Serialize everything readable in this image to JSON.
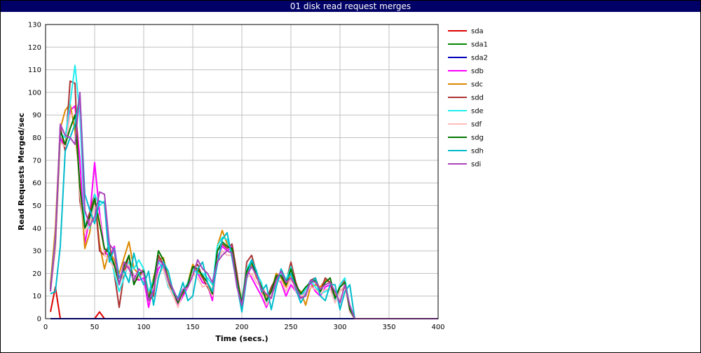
{
  "window": {
    "title": "01 disk read request merges"
  },
  "chart_data": {
    "type": "line",
    "title": "01 disk read request merges",
    "xlabel": "Time (secs.)",
    "ylabel": "Read Requests Merged/sec",
    "xlim": [
      0,
      400
    ],
    "ylim": [
      0,
      130
    ],
    "xticks": [
      0,
      50,
      100,
      150,
      200,
      250,
      300,
      350,
      400
    ],
    "yticks": [
      0,
      10,
      20,
      30,
      40,
      50,
      60,
      70,
      80,
      90,
      100,
      110,
      120,
      130
    ],
    "grid": true,
    "legend_position": "right",
    "x": [
      5,
      10,
      15,
      20,
      25,
      30,
      35,
      40,
      45,
      50,
      55,
      60,
      65,
      70,
      75,
      80,
      85,
      90,
      95,
      100,
      105,
      110,
      115,
      120,
      125,
      130,
      135,
      140,
      145,
      150,
      155,
      160,
      165,
      170,
      175,
      180,
      185,
      190,
      195,
      200,
      205,
      210,
      215,
      220,
      225,
      230,
      235,
      240,
      245,
      250,
      255,
      260,
      265,
      270,
      275,
      280,
      285,
      290,
      295,
      300,
      305,
      310,
      315,
      320,
      325,
      330,
      340,
      350,
      360,
      370,
      380,
      390,
      400
    ],
    "series": [
      {
        "name": "sda",
        "color": "#dd0000",
        "values": [
          3,
          14,
          0,
          0,
          0,
          0,
          0,
          0,
          0,
          0,
          3,
          0,
          0,
          0,
          0,
          0,
          0,
          0,
          0,
          0,
          0,
          0,
          0,
          0,
          0,
          0,
          0,
          0,
          0,
          0,
          0,
          0,
          0,
          0,
          0,
          0,
          0,
          0,
          0,
          0,
          0,
          0,
          0,
          0,
          0,
          0,
          0,
          0,
          0,
          0,
          0,
          0,
          0,
          0,
          0,
          0,
          0,
          0,
          0,
          0,
          0,
          0,
          0,
          0,
          0,
          0,
          0,
          0,
          0,
          0,
          0,
          0,
          0
        ]
      },
      {
        "name": "sda1",
        "color": "#008800",
        "values": [
          0,
          0,
          0,
          0,
          0,
          0,
          0,
          0,
          0,
          0,
          0,
          0,
          0,
          0,
          0,
          0,
          0,
          0,
          0,
          0,
          0,
          0,
          0,
          0,
          0,
          0,
          0,
          0,
          0,
          0,
          0,
          0,
          0,
          0,
          0,
          0,
          0,
          0,
          0,
          0,
          0,
          0,
          0,
          0,
          0,
          0,
          0,
          0,
          0,
          0,
          0,
          0,
          0,
          0,
          0,
          0,
          0,
          0,
          0,
          0,
          0,
          0,
          0,
          0,
          0,
          0,
          0,
          0,
          0,
          0,
          0,
          0,
          0
        ]
      },
      {
        "name": "sda2",
        "color": "#0000bb",
        "values": [
          0,
          0,
          0,
          0,
          0,
          0,
          0,
          0,
          0,
          0,
          0,
          0,
          0,
          0,
          0,
          0,
          0,
          0,
          0,
          0,
          0,
          0,
          0,
          0,
          0,
          0,
          0,
          0,
          0,
          0,
          0,
          0,
          0,
          0,
          0,
          0,
          0,
          0,
          0,
          0,
          0,
          0,
          0,
          0,
          0,
          0,
          0,
          0,
          0,
          0,
          0,
          0,
          0,
          0,
          0,
          0,
          0,
          0,
          0,
          0,
          0,
          0,
          0,
          0,
          0,
          0,
          0,
          0,
          0,
          0,
          0,
          0,
          0
        ]
      },
      {
        "name": "sdb",
        "color": "#ff00ff",
        "values": [
          12,
          38,
          80,
          75,
          92,
          94,
          70,
          33,
          45,
          69,
          47,
          30,
          27,
          32,
          18,
          22,
          23,
          19,
          17,
          18,
          5,
          15,
          22,
          25,
          15,
          10,
          6,
          10,
          14,
          23,
          20,
          16,
          15,
          8,
          27,
          32,
          30,
          32,
          15,
          5,
          22,
          18,
          14,
          10,
          5,
          10,
          18,
          16,
          10,
          15,
          12,
          9,
          13,
          16,
          12,
          10,
          14,
          15,
          9,
          14,
          16,
          3,
          0,
          0,
          0,
          0,
          0,
          0,
          0,
          0,
          0,
          0,
          0
        ]
      },
      {
        "name": "sdc",
        "color": "#dd8800",
        "values": [
          15,
          40,
          84,
          92,
          95,
          83,
          60,
          31,
          38,
          54,
          33,
          22,
          30,
          26,
          20,
          27,
          34,
          22,
          20,
          21,
          10,
          18,
          26,
          27,
          18,
          12,
          8,
          12,
          16,
          24,
          21,
          18,
          14,
          12,
          32,
          39,
          33,
          30,
          18,
          8,
          20,
          24,
          18,
          15,
          10,
          12,
          20,
          18,
          14,
          20,
          14,
          12,
          6,
          14,
          15,
          14,
          17,
          16,
          10,
          12,
          14,
          5,
          0,
          0,
          0,
          0,
          0,
          0,
          0,
          0,
          0,
          0,
          0
        ]
      },
      {
        "name": "sdd",
        "color": "#aa3333",
        "values": [
          14,
          35,
          85,
          74,
          105,
          104,
          52,
          40,
          47,
          55,
          30,
          28,
          33,
          20,
          5,
          20,
          28,
          16,
          18,
          22,
          8,
          10,
          28,
          24,
          16,
          12,
          7,
          11,
          15,
          22,
          24,
          18,
          14,
          10,
          30,
          33,
          31,
          33,
          20,
          5,
          25,
          28,
          20,
          12,
          8,
          14,
          18,
          20,
          16,
          25,
          16,
          10,
          13,
          17,
          18,
          12,
          18,
          16,
          8,
          15,
          17,
          4,
          0,
          0,
          0,
          0,
          0,
          0,
          0,
          0,
          0,
          0,
          0
        ]
      },
      {
        "name": "sde",
        "color": "#22eeee",
        "values": [
          13,
          36,
          82,
          80,
          95,
          112,
          90,
          42,
          40,
          55,
          50,
          52,
          30,
          20,
          12,
          18,
          25,
          22,
          26,
          22,
          12,
          17,
          25,
          22,
          14,
          11,
          9,
          12,
          16,
          22,
          20,
          20,
          18,
          15,
          32,
          36,
          35,
          28,
          16,
          8,
          22,
          26,
          20,
          16,
          7,
          10,
          15,
          20,
          17,
          23,
          14,
          10,
          13,
          17,
          14,
          11,
          12,
          13,
          8,
          15,
          18,
          5,
          0,
          0,
          0,
          0,
          0,
          0,
          0,
          0,
          0,
          0,
          0
        ]
      },
      {
        "name": "sdf",
        "color": "#ffbbbb",
        "values": [
          12,
          30,
          78,
          76,
          90,
          90,
          55,
          38,
          42,
          50,
          45,
          28,
          26,
          22,
          16,
          20,
          24,
          18,
          18,
          20,
          10,
          14,
          20,
          22,
          15,
          10,
          5,
          12,
          14,
          20,
          18,
          14,
          15,
          10,
          26,
          30,
          28,
          28,
          16,
          6,
          18,
          20,
          16,
          14,
          6,
          10,
          16,
          17,
          12,
          18,
          12,
          10,
          11,
          14,
          13,
          11,
          13,
          13,
          7,
          12,
          15,
          3,
          0,
          0,
          0,
          0,
          0,
          0,
          0,
          0,
          0,
          0,
          0
        ]
      },
      {
        "name": "sdg",
        "color": "#007700",
        "values": [
          13,
          34,
          83,
          77,
          84,
          90,
          58,
          40,
          45,
          53,
          42,
          31,
          29,
          24,
          15,
          23,
          28,
          15,
          20,
          21,
          9,
          16,
          30,
          26,
          17,
          12,
          7,
          12,
          15,
          23,
          22,
          19,
          16,
          11,
          30,
          34,
          32,
          31,
          17,
          7,
          21,
          25,
          19,
          14,
          8,
          12,
          19,
          19,
          15,
          22,
          15,
          11,
          14,
          16,
          17,
          12,
          16,
          18,
          9,
          14,
          16,
          4,
          0,
          0,
          0,
          0,
          0,
          0,
          0,
          0,
          0,
          0,
          0
        ]
      },
      {
        "name": "sdh",
        "color": "#00bbcc",
        "values": [
          11,
          12,
          32,
          74,
          80,
          86,
          99,
          55,
          48,
          42,
          52,
          51,
          25,
          31,
          18,
          21,
          16,
          29,
          20,
          15,
          21,
          6,
          18,
          25,
          21,
          12,
          9,
          16,
          8,
          10,
          22,
          25,
          16,
          12,
          24,
          35,
          38,
          27,
          15,
          3,
          18,
          26,
          21,
          12,
          15,
          4,
          14,
          22,
          17,
          20,
          13,
          7,
          11,
          16,
          18,
          10,
          8,
          15,
          15,
          4,
          12,
          15,
          0,
          0,
          0,
          0,
          0,
          0,
          0,
          0,
          0,
          0,
          0
        ]
      },
      {
        "name": "sdi",
        "color": "#aa44bb",
        "values": [
          12,
          35,
          86,
          81,
          80,
          77,
          100,
          48,
          41,
          45,
          56,
          55,
          33,
          30,
          15,
          25,
          22,
          17,
          22,
          20,
          8,
          12,
          26,
          24,
          17,
          13,
          8,
          13,
          14,
          19,
          26,
          22,
          20,
          16,
          25,
          28,
          30,
          29,
          14,
          6,
          19,
          23,
          19,
          13,
          11,
          9,
          17,
          21,
          16,
          18,
          14,
          9,
          10,
          17,
          16,
          13,
          15,
          16,
          12,
          7,
          15,
          6,
          0,
          0,
          0,
          0,
          0,
          0,
          0,
          0,
          0,
          0,
          0
        ]
      }
    ]
  }
}
